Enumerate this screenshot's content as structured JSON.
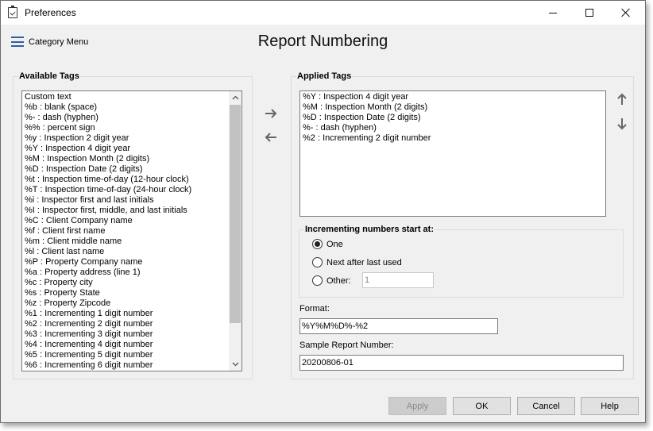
{
  "window": {
    "title": "Preferences"
  },
  "menu": {
    "label": "Category Menu"
  },
  "page": {
    "title": "Report Numbering"
  },
  "available_tags": {
    "label": "Available Tags",
    "items": [
      "Custom text",
      "%b : blank (space)",
      "%- : dash (hyphen)",
      "%% : percent sign",
      "%y : Inspection 2 digit year",
      "%Y : Inspection 4 digit year",
      "%M : Inspection Month (2 digits)",
      "%D : Inspection Date (2 digits)",
      "%t : Inspection time-of-day (12-hour clock)",
      "%T : Inspection time-of-day (24-hour clock)",
      "%i : Inspector first and last initials",
      "%I : Inspector first, middle, and last initials",
      "%C : Client Company name",
      "%f : Client first name",
      "%m : Client middle name",
      "%l : Client last name",
      "%P : Property Company name",
      "%a : Property address (line 1)",
      "%c : Property city",
      "%s : Property State",
      "%z : Property Zipcode",
      "%1 : Incrementing 1 digit number",
      "%2 : Incrementing 2 digit number",
      "%3 : Incrementing 3 digit number",
      "%4 : Incrementing 4 digit number",
      "%5 : Incrementing 5 digit number",
      "%6 : Incrementing 6 digit number"
    ]
  },
  "applied_tags": {
    "label": "Applied Tags",
    "items": [
      "%Y : Inspection 4 digit year",
      "%M : Inspection Month (2 digits)",
      "%D : Inspection Date (2 digits)",
      "%- : dash (hyphen)",
      "%2 : Incrementing 2 digit number"
    ]
  },
  "incrementing": {
    "label": "Incrementing numbers start at:",
    "options": [
      "One",
      "Next after last used",
      "Other:"
    ],
    "selected": "One",
    "other_value": "1"
  },
  "format": {
    "label": "Format:",
    "value": "%Y%M%D%-%2"
  },
  "sample": {
    "label": "Sample Report Number:",
    "value": "20200806-01"
  },
  "buttons": {
    "apply": "Apply",
    "ok": "OK",
    "cancel": "Cancel",
    "help": "Help"
  },
  "icons": {
    "move_right": "arrow-right-icon",
    "move_left": "arrow-left-icon",
    "move_up": "arrow-up-icon",
    "move_down": "arrow-down-icon"
  },
  "colors": {
    "accent": "#2f5fa0",
    "arrow": "#666666"
  }
}
